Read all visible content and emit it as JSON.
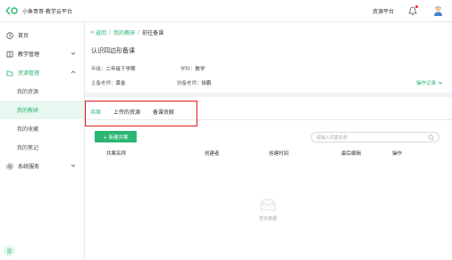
{
  "header": {
    "app_title": "小鱼哥哥·教学云平台",
    "resource_platform": "资源平台",
    "brand_color": "#2bb673"
  },
  "sidebar": {
    "items": [
      {
        "label": "首页",
        "icon": "clock-icon"
      },
      {
        "label": "教学管理",
        "icon": "book-icon",
        "expandable": true
      },
      {
        "label": "资源管理",
        "icon": "folder-icon",
        "expanded": true
      },
      {
        "label": "我的资源"
      },
      {
        "label": "我的教研",
        "selected": true
      },
      {
        "label": "我的收藏"
      },
      {
        "label": "我的笔记"
      },
      {
        "label": "系统服务",
        "icon": "gear-icon",
        "expandable": true
      }
    ]
  },
  "breadcrumb": {
    "back": "返回",
    "parent": "我的教研",
    "separator": "/",
    "current": "前往备课"
  },
  "page": {
    "title": "认识四边形备课",
    "grade_label": "年级：",
    "grade_value": "二年级下学期",
    "subject_label": "学科：",
    "subject_value": "数学",
    "lead_label": "主备老师：",
    "lead_value": "黄金",
    "co_label": "协备老师：",
    "co_value": "徐鹏",
    "ops_link": "操作记录"
  },
  "tabs": [
    {
      "label": "共案",
      "active": true
    },
    {
      "label": "上传的资源"
    },
    {
      "label": "备课贡献"
    }
  ],
  "toolbar": {
    "new_button": "+ 新建共案",
    "search_placeholder": "请输入共案名称"
  },
  "table": {
    "columns": [
      "共案名称",
      "创建者",
      "创建时间",
      "最后编辑",
      "操作"
    ]
  },
  "empty_state": {
    "text": "暂无数据"
  }
}
